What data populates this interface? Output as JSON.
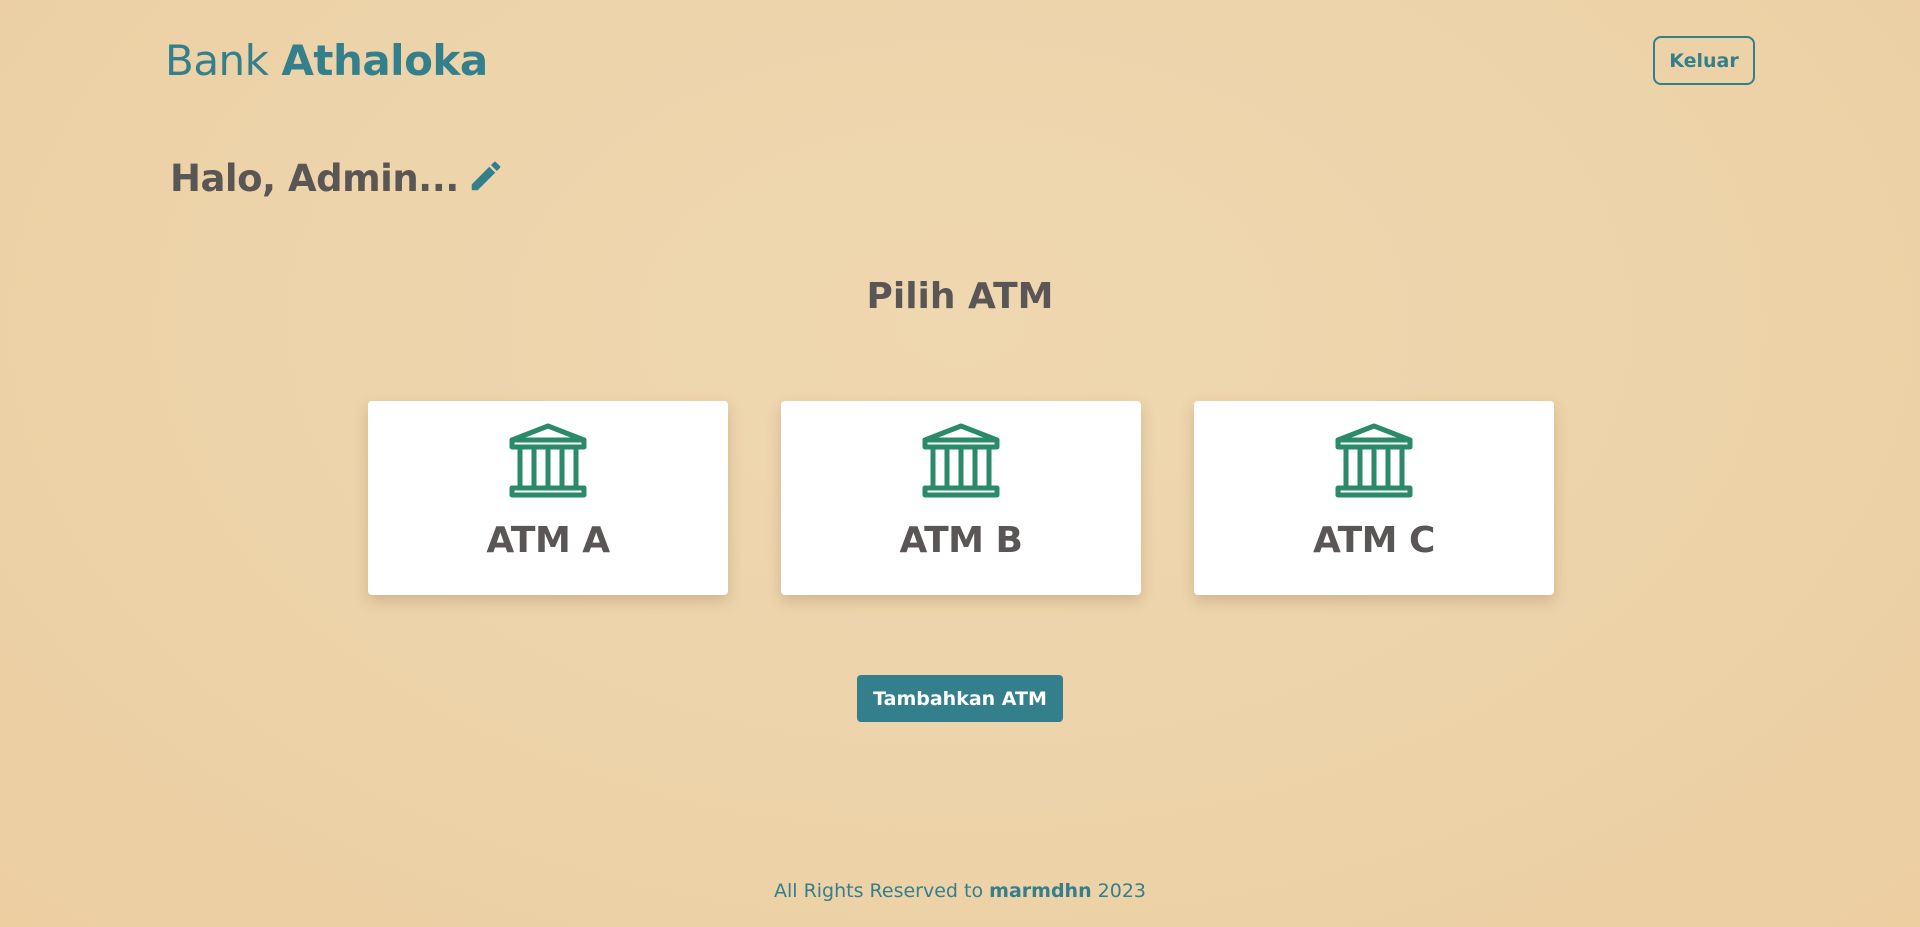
{
  "header": {
    "brand_prefix": "Bank",
    "brand_name": "Athaloka",
    "logout_label": "Keluar"
  },
  "greeting": {
    "text": "Halo, Admin...",
    "edit_icon": "pencil-icon"
  },
  "main": {
    "title": "Pilih ATM",
    "atms": [
      {
        "label": "ATM A",
        "icon": "bank-icon"
      },
      {
        "label": "ATM B",
        "icon": "bank-icon"
      },
      {
        "label": "ATM C",
        "icon": "bank-icon"
      }
    ],
    "add_button_label": "Tambahkan ATM"
  },
  "footer": {
    "prefix": "All Rights Reserved to",
    "author": "marmdhn",
    "year": "2023"
  },
  "colors": {
    "accent": "#347f8c",
    "icon_green": "#2a8a6a",
    "background": "#edd3a9",
    "text": "#5a5656"
  }
}
